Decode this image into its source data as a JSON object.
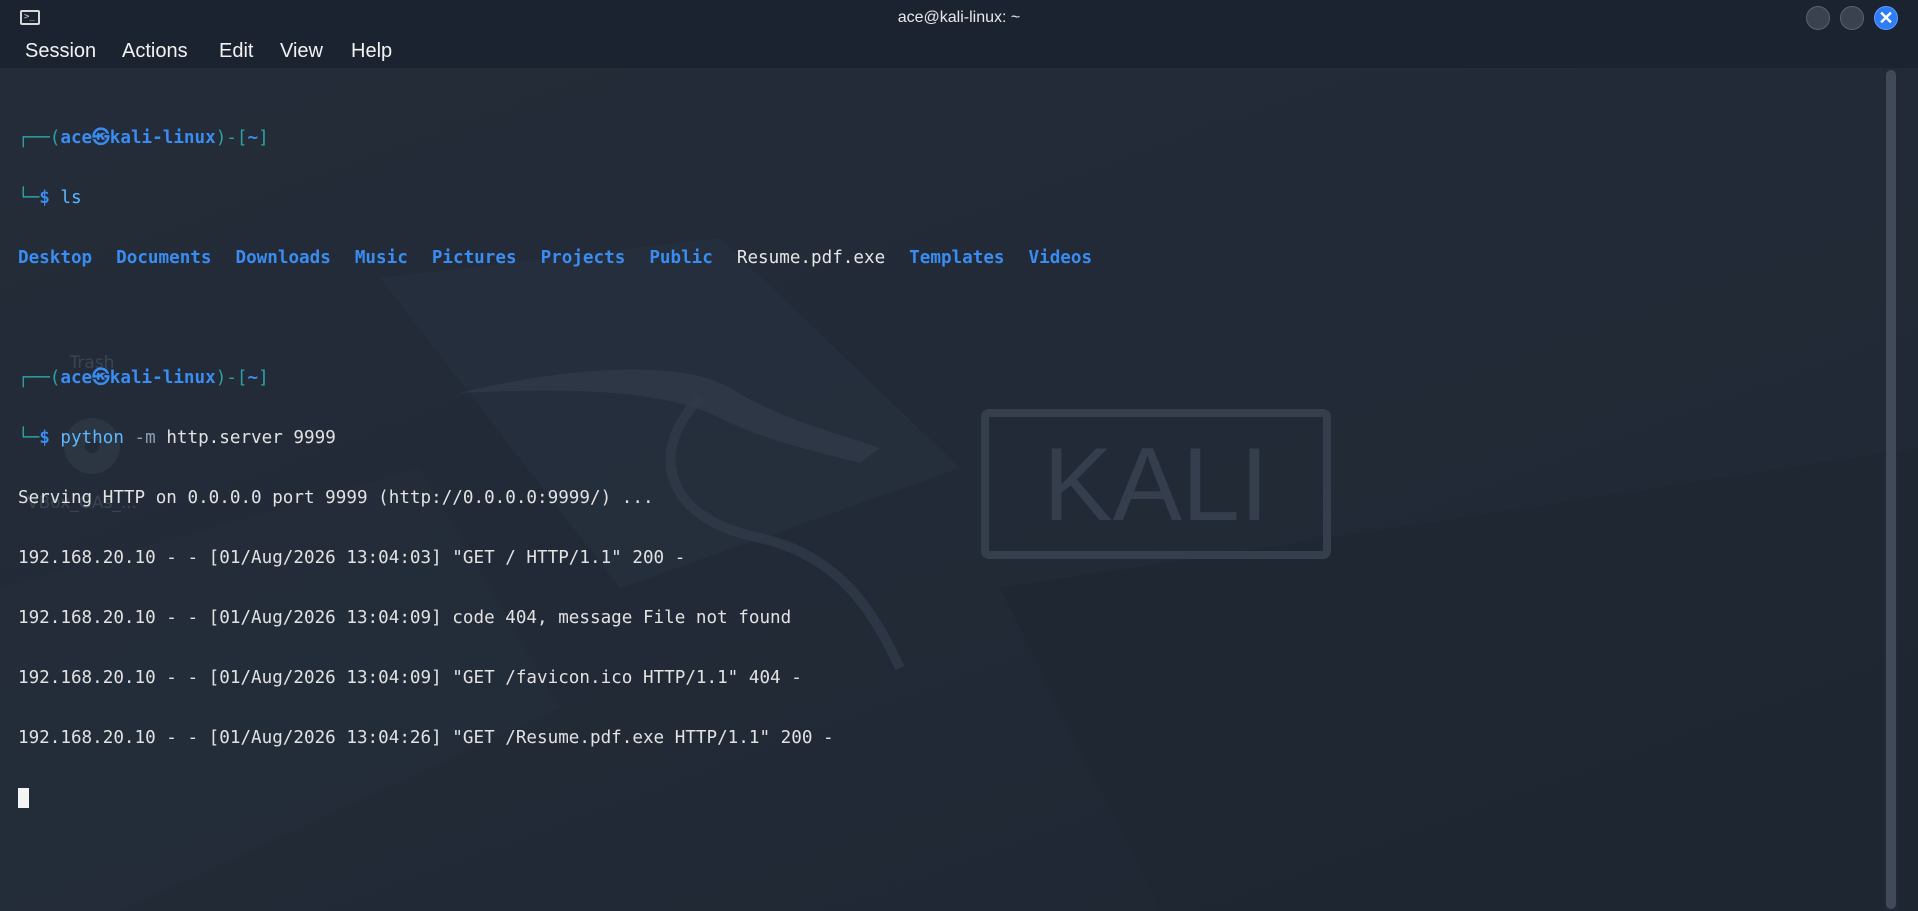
{
  "window": {
    "title": "ace@kali-linux: ~",
    "icon": "terminal-icon",
    "controls": [
      "minimize-icon",
      "maximize-icon",
      "close-icon"
    ]
  },
  "menu": [
    "Session",
    "Actions",
    "Edit",
    "View",
    "Help"
  ],
  "wallpaper": {
    "logo_text": "KALI",
    "desktop_icons": [
      "Trash",
      "VBox_GAs_..."
    ]
  },
  "terminal": {
    "prompt1": {
      "user": "ace",
      "host": "kali-linux",
      "dir": "~",
      "command": "ls"
    },
    "ls_entries": [
      {
        "name": "Desktop",
        "type": "dir"
      },
      {
        "name": "Documents",
        "type": "dir"
      },
      {
        "name": "Downloads",
        "type": "dir"
      },
      {
        "name": "Music",
        "type": "dir"
      },
      {
        "name": "Pictures",
        "type": "dir"
      },
      {
        "name": "Projects",
        "type": "dir"
      },
      {
        "name": "Public",
        "type": "dir"
      },
      {
        "name": "Resume.pdf.exe",
        "type": "file"
      },
      {
        "name": "Templates",
        "type": "dir"
      },
      {
        "name": "Videos",
        "type": "dir"
      }
    ],
    "prompt2": {
      "user": "ace",
      "host": "kali-linux",
      "dir": "~",
      "cmd_word": "python",
      "cmd_flag": "-m",
      "cmd_args": "http.server 9999"
    },
    "server_output": [
      "Serving HTTP on 0.0.0.0 port 9999 (http://0.0.0.0:9999/) ...",
      "192.168.20.10 - - [01/Aug/2026 13:04:03] \"GET / HTTP/1.1\" 200 -",
      "192.168.20.10 - - [01/Aug/2026 13:04:09] code 404, message File not found",
      "192.168.20.10 - - [01/Aug/2026 13:04:09] \"GET /favicon.ico HTTP/1.1\" 404 -",
      "192.168.20.10 - - [01/Aug/2026 13:04:26] \"GET /Resume.pdf.exe HTTP/1.1\" 200 -"
    ]
  },
  "colors": {
    "background": "#222a37",
    "dir_blue": "#3a8cf0",
    "prompt_frame": "#2aa3a5",
    "command": "#5fb7ff",
    "text": "#e2e2e2"
  }
}
